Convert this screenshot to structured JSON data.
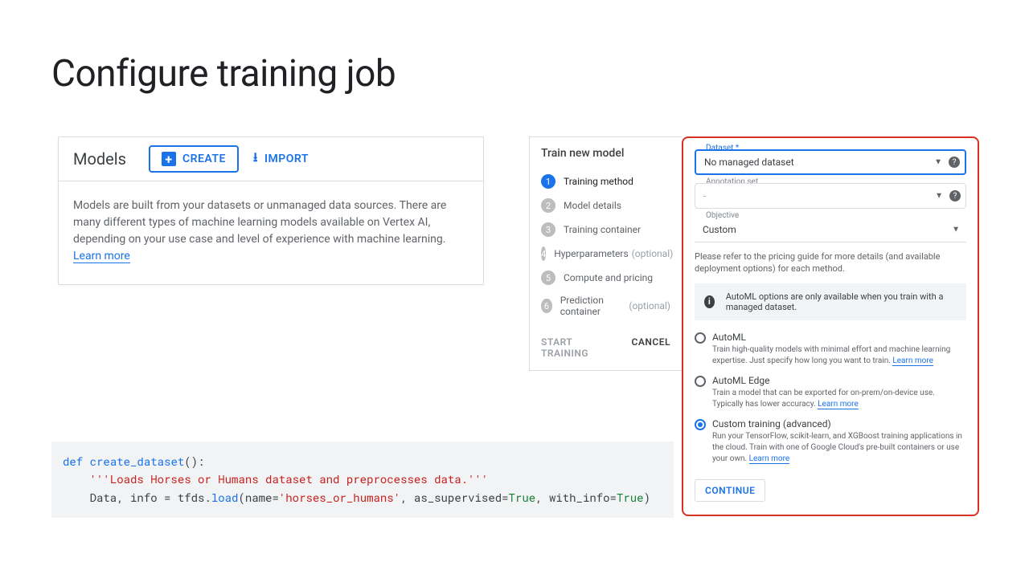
{
  "page": {
    "title": "Configure training job"
  },
  "models": {
    "heading": "Models",
    "create_label": "CREATE",
    "import_label": "IMPORT",
    "description": "Models are built from your datasets or unmanaged data sources. There are many different types of machine learning models available on Vertex AI, depending on your use case and level of experience with machine learning. ",
    "learn_more": "Learn more"
  },
  "wizard": {
    "title": "Train new model",
    "steps": [
      {
        "num": "1",
        "label": "Training method",
        "active": true
      },
      {
        "num": "2",
        "label": "Model details"
      },
      {
        "num": "3",
        "label": "Training container"
      },
      {
        "num": "4",
        "label": "Hyperparameters",
        "optional": "(optional)"
      },
      {
        "num": "5",
        "label": "Compute and pricing"
      },
      {
        "num": "6",
        "label": "Prediction container",
        "optional": "(optional)"
      }
    ],
    "start": "START TRAINING",
    "cancel": "CANCEL"
  },
  "detail": {
    "dataset_label": "Dataset *",
    "dataset_value": "No managed dataset",
    "annotation_label": "Annotation set",
    "annotation_value": "-",
    "objective_label": "Objective",
    "objective_value": "Custom",
    "pricing_note": "Please refer to the pricing guide for more details (and available deployment options) for each method.",
    "info_banner": "AutoML options are only available when you train with a managed dataset.",
    "options": {
      "automl": {
        "title": "AutoML",
        "desc": "Train high-quality models with minimal effort and machine learning expertise. Just specify how long you want to train. ",
        "learn": "Learn more"
      },
      "automl_edge": {
        "title": "AutoML Edge",
        "desc": "Train a model that can be exported for on-prem/on-device use. Typically has lower accuracy. ",
        "learn": "Learn more"
      },
      "custom": {
        "title": "Custom training (advanced)",
        "desc": "Run your TensorFlow, scikit-learn, and XGBoost training applications in the cloud. Train with one of Google Cloud's pre-built containers or use your own. ",
        "learn": "Learn more"
      }
    },
    "continue": "CONTINUE"
  },
  "code": {
    "def": "def",
    "fn": "create_dataset",
    "paren": "():",
    "doc": "'''Loads Horses or Humans dataset and preprocesses data.'''",
    "line3a": "    Data, info = tfds.",
    "load": "load",
    "line3b": "(name=",
    "str": "'horses_or_humans'",
    "line3c": ", as_supervised=",
    "true1": "True",
    "line3d": ", with_info=",
    "true2": "True",
    "line3e": ")"
  }
}
